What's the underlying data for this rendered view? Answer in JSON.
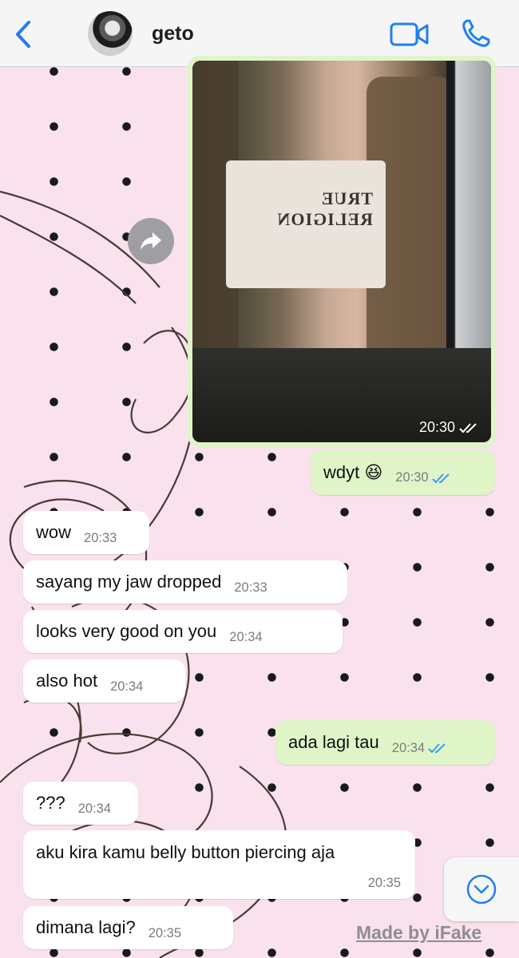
{
  "header": {
    "contact_name": "geto",
    "back_icon": "chevron-left-icon",
    "video_icon": "video-camera-icon",
    "phone_icon": "phone-icon",
    "accent_color": "#1f7ef3"
  },
  "photo_message": {
    "tank_print": "TRUE RELIGION",
    "time": "20:30",
    "status": "read"
  },
  "forward_button": {
    "icon": "forward-arrow-icon"
  },
  "messages": [
    {
      "direction": "out",
      "text": "wdyt 😆",
      "time": "20:30",
      "status": "read"
    },
    {
      "direction": "in",
      "text": "wow",
      "time": "20:33"
    },
    {
      "direction": "in",
      "text": "sayang my jaw dropped",
      "time": "20:33"
    },
    {
      "direction": "in",
      "text": "looks very good on you",
      "time": "20:34"
    },
    {
      "direction": "in",
      "text": "also hot",
      "time": "20:34"
    },
    {
      "direction": "out",
      "text": "ada lagi tau",
      "time": "20:34",
      "status": "read"
    },
    {
      "direction": "in",
      "text": "???",
      "time": "20:34"
    },
    {
      "direction": "in",
      "text": "aku kira kamu belly button piercing aja",
      "time": "20:35"
    },
    {
      "direction": "in",
      "text": "dimana lagi?",
      "time": "20:35"
    }
  ],
  "scroll_down_button": {
    "icon": "chevron-down-circle-icon"
  },
  "watermark": "Made by iFake",
  "colors": {
    "wallpaper": "#f9e1ee",
    "incoming_bubble": "#ffffff",
    "outgoing_bubble": "#dff5c8",
    "read_ticks": "#3b9ef0"
  }
}
